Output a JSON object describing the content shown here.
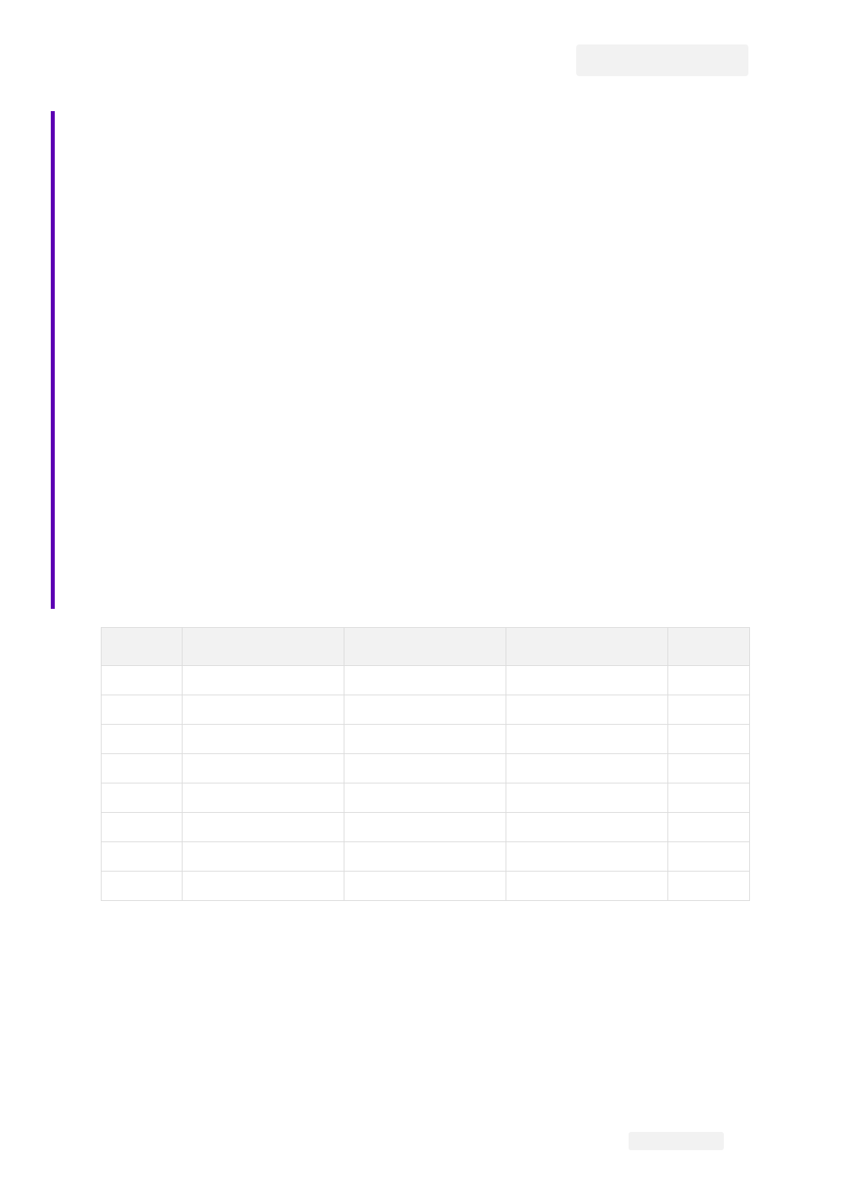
{
  "header": {
    "badge_text": ""
  },
  "accent": {
    "color": "#5c00b3"
  },
  "body": {
    "text": ""
  },
  "table": {
    "headers": [
      "",
      "",
      "",
      "",
      ""
    ],
    "rows": [
      [
        "",
        "",
        "",
        "",
        ""
      ],
      [
        "",
        "",
        "",
        "",
        ""
      ],
      [
        "",
        "",
        "",
        "",
        ""
      ],
      [
        "",
        "",
        "",
        "",
        ""
      ],
      [
        "",
        "",
        "",
        "",
        ""
      ],
      [
        "",
        "",
        "",
        "",
        ""
      ],
      [
        "",
        "",
        "",
        "",
        ""
      ],
      [
        "",
        "",
        "",
        "",
        ""
      ]
    ]
  },
  "footer": {
    "badge_text": ""
  }
}
